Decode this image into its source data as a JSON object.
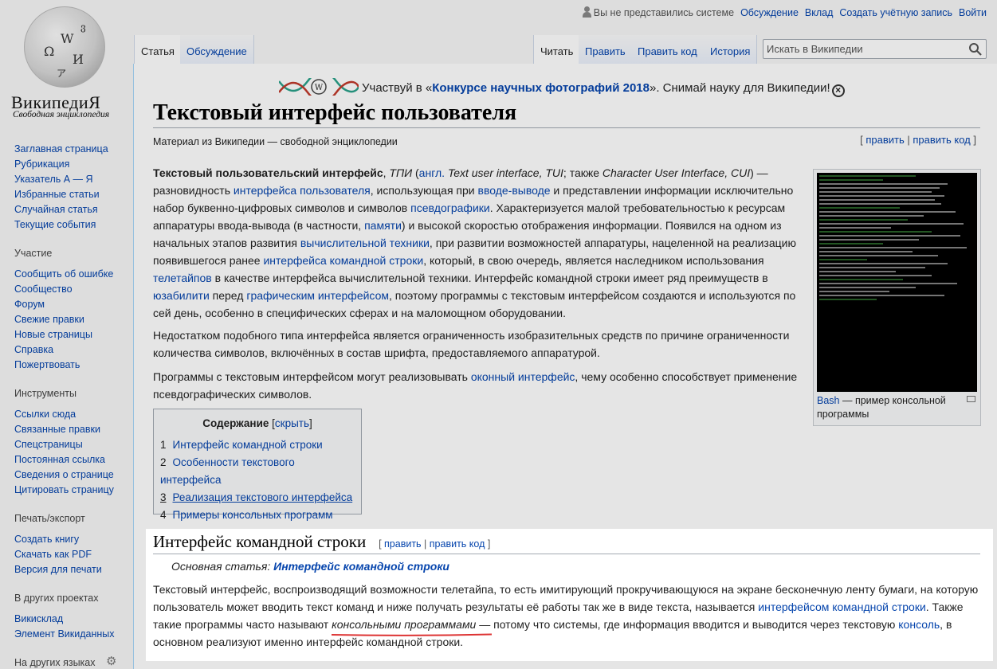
{
  "logo": {
    "title": "ВикипедиЯ",
    "subtitle": "Свободная энциклопедия",
    "glyphs": [
      "W",
      "Ω",
      "И",
      "ア",
      "ვ"
    ]
  },
  "personal": {
    "not_logged": "Вы не представились системе",
    "links": [
      "Обсуждение",
      "Вклад",
      "Создать учётную запись",
      "Войти"
    ]
  },
  "tabs": {
    "left": [
      "Статья",
      "Обсуждение"
    ],
    "right": [
      "Читать",
      "Править",
      "Править код",
      "История"
    ]
  },
  "search": {
    "placeholder": "Искать в Википедии"
  },
  "sidebar": {
    "main": [
      "Заглавная страница",
      "Рубрикация",
      "Указатель А — Я",
      "Избранные статьи",
      "Случайная статья",
      "Текущие события"
    ],
    "participation": {
      "title": "Участие",
      "items": [
        "Сообщить об ошибке",
        "Сообщество",
        "Форум",
        "Свежие правки",
        "Новые страницы",
        "Справка",
        "Пожертвовать"
      ]
    },
    "tools": {
      "title": "Инструменты",
      "items": [
        "Ссылки сюда",
        "Связанные правки",
        "Спецстраницы",
        "Постоянная ссылка",
        "Сведения о странице",
        "Цитировать страницу"
      ]
    },
    "print": {
      "title": "Печать/экспорт",
      "items": [
        "Создать книгу",
        "Скачать как PDF",
        "Версия для печати"
      ]
    },
    "projects": {
      "title": "В других проектах",
      "items": [
        "Викисклад",
        "Элемент Викиданных"
      ]
    },
    "languages": {
      "title": "На других языках"
    }
  },
  "notice": {
    "prefix": "Участвуй в «",
    "link": "Конкурсе научных фотографий 2018",
    "suffix": "». Снимай науку для Википедии!"
  },
  "article": {
    "title": "Текстовый интерфейс пользователя",
    "from": "Материал из Википедии — свободной энциклопедии",
    "edit": "править",
    "edit_code": "править код"
  },
  "thumb": {
    "link": "Bash",
    "caption": " — пример консольной программы"
  },
  "toc": {
    "title": "Содержание",
    "hide": "скрыть",
    "items": [
      {
        "num": "1",
        "label": "Интерфейс командной строки"
      },
      {
        "num": "2",
        "label": "Особенности текстового интерфейса"
      },
      {
        "num": "3",
        "label": "Реализация текстового интерфейса"
      },
      {
        "num": "4",
        "label": "Примеры консольных программ"
      }
    ]
  },
  "section": {
    "title": "Интерфейс командной строки",
    "edit": "править",
    "edit_code": "править код",
    "main_prefix": "Основная статья: ",
    "main_link": "Интерфейс командной строки"
  },
  "colors": {
    "link": "#0645ad",
    "underline": "#d33"
  }
}
